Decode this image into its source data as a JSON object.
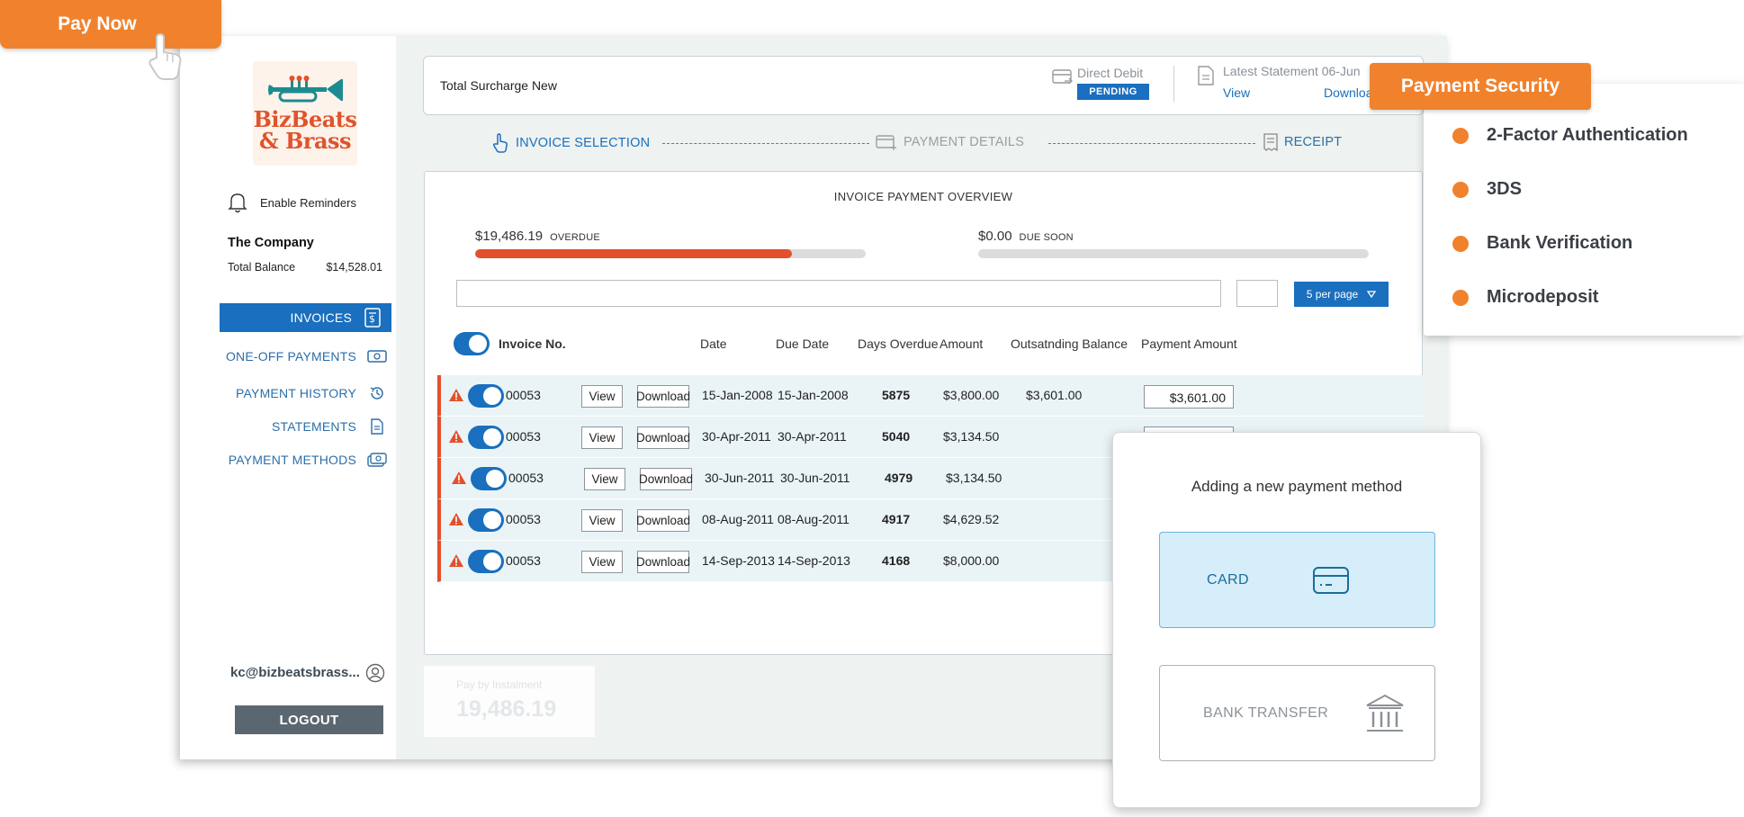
{
  "pay_now": {
    "label": "Pay Now"
  },
  "sidebar": {
    "logo_line1": "BizBeats",
    "logo_line2": "& Brass",
    "reminders_label": "Enable Reminders",
    "company_name": "The Company",
    "total_balance_label": "Total Balance",
    "total_balance_value": "$14,528.01",
    "nav": [
      {
        "label": "INVOICES",
        "icon": "invoice-icon",
        "active": true
      },
      {
        "label": "ONE-OFF PAYMENTS",
        "icon": "cash-icon"
      },
      {
        "label": "PAYMENT HISTORY",
        "icon": "history-icon"
      },
      {
        "label": "STATEMENTS",
        "icon": "document-icon"
      },
      {
        "label": "PAYMENT METHODS",
        "icon": "money-icon"
      }
    ],
    "user_email": "kc@bizbeatsbrass...",
    "logout_label": "LOGOUT"
  },
  "header_card": {
    "title": "Total Surcharge New",
    "direct_debit_label": "Direct Debit",
    "direct_debit_status": "PENDING",
    "statement_label": "Latest Statement 06-Jun",
    "view_link": "View",
    "download_link": "Downloa"
  },
  "steps": [
    {
      "label": "INVOICE SELECTION",
      "state": "active"
    },
    {
      "label": "PAYMENT DETAILS",
      "state": "inactive"
    },
    {
      "label": "RECEIPT",
      "state": "upcoming"
    }
  ],
  "overview": {
    "title": "INVOICE PAYMENT OVERVIEW",
    "overdue_amount": "$19,486.19",
    "overdue_label": "OVERDUE",
    "overdue_fill_fraction": 0.81,
    "due_soon_amount": "$0.00",
    "due_soon_label": "DUE SOON",
    "due_soon_fill_fraction": 0,
    "per_page_label": "5 per page"
  },
  "table": {
    "columns": [
      "Invoice No.",
      "Date",
      "Due Date",
      "Days Overdue",
      "Amount",
      "Outsatnding Balance",
      "Payment Amount"
    ],
    "view_label": "View",
    "download_label": "Download",
    "rows": [
      {
        "invoice": "00053",
        "date": "15-Jan-2008",
        "due": "15-Jan-2008",
        "days": "5875",
        "amount": "$3,800.00",
        "outstanding": "$3,601.00",
        "payment": "$3,601.00"
      },
      {
        "invoice": "00053",
        "date": "30-Apr-2011",
        "due": "30-Apr-2011",
        "days": "5040",
        "amount": "$3,134.50"
      },
      {
        "invoice": "00053",
        "date": "30-Jun-2011",
        "due": "30-Jun-2011",
        "days": "4979",
        "amount": "$3,134.50"
      },
      {
        "invoice": "00053",
        "date": "08-Aug-2011",
        "due": "08-Aug-2011",
        "days": "4917",
        "amount": "$4,629.52"
      },
      {
        "invoice": "00053",
        "date": "14-Sep-2013",
        "due": "14-Sep-2013",
        "days": "4168",
        "amount": "$8,000.00"
      }
    ]
  },
  "instalment": {
    "label": "Pay by Instalment",
    "amount": "19,486.19"
  },
  "security": {
    "title": "Payment Security",
    "items": [
      "2-Factor Authentication",
      "3DS",
      "Bank Verification",
      "Microdeposit"
    ]
  },
  "payment_method": {
    "title": "Adding a new payment method",
    "card_label": "CARD",
    "bank_label": "BANK TRANSFER"
  },
  "colors": {
    "accent_blue": "#1a6fbe",
    "brand_orange": "#f0822d",
    "overdue_red": "#e2502c"
  }
}
